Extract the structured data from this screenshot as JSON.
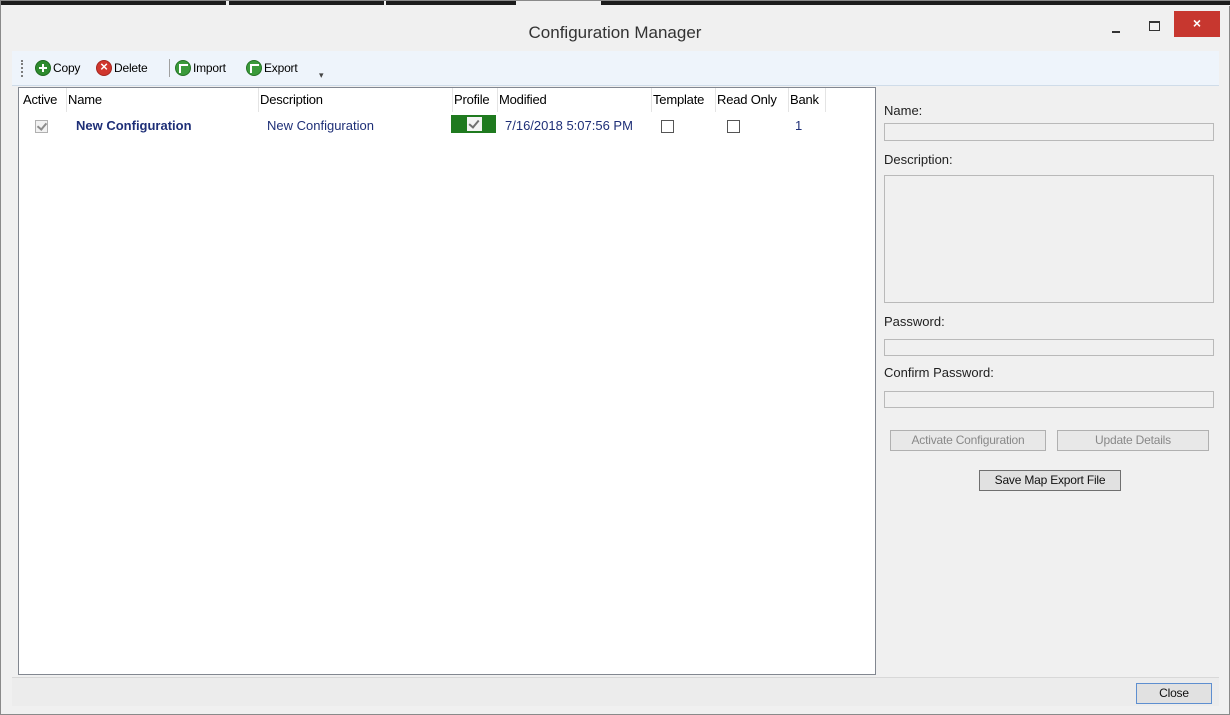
{
  "window": {
    "title": "Configuration Manager",
    "close_glyph": "×"
  },
  "toolbar": {
    "items": [
      {
        "label": "Copy",
        "icon": "add-icon"
      },
      {
        "label": "Delete",
        "icon": "delete-icon"
      },
      {
        "label": "Import",
        "icon": "import-icon"
      },
      {
        "label": "Export",
        "icon": "export-icon"
      }
    ],
    "overflow_glyph": "▾"
  },
  "grid": {
    "columns": [
      "Active",
      "Name",
      "Description",
      "Profile",
      "Modified",
      "Template",
      "Read Only",
      "Bank"
    ],
    "rows": [
      {
        "active": true,
        "name": "New Configuration",
        "description": "New Configuration",
        "profile": true,
        "modified": "7/16/2018 5:07:56 PM",
        "template": false,
        "read_only": false,
        "bank": "1"
      }
    ]
  },
  "details": {
    "name_label": "Name:",
    "name_value": "",
    "description_label": "Description:",
    "description_value": "",
    "password_label": "Password:",
    "password_value": "",
    "confirm_password_label": "Confirm Password:",
    "confirm_password_value": "",
    "activate_button": "Activate Configuration",
    "update_button": "Update Details",
    "save_map_button": "Save Map Export File"
  },
  "footer": {
    "close_button": "Close"
  },
  "colors": {
    "profile_green": "#1f7a1f",
    "row_text": "#1e2f77",
    "close_red": "#c7372f"
  }
}
